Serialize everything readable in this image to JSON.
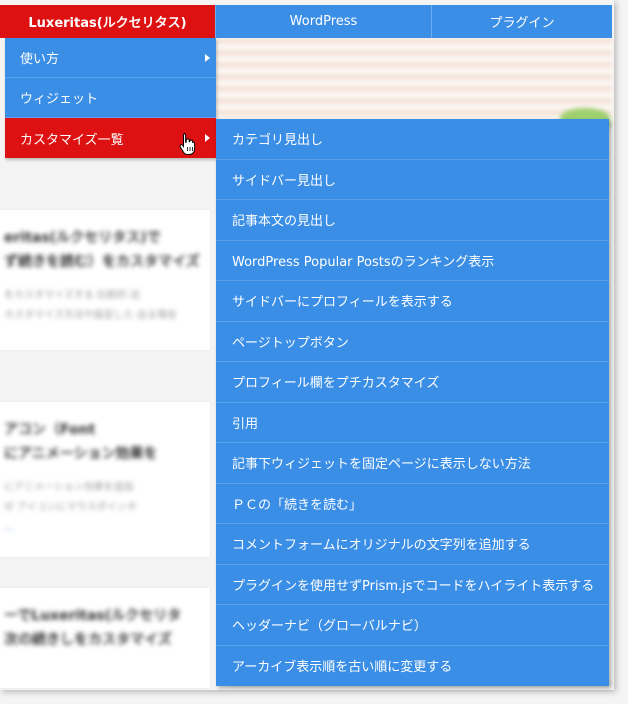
{
  "menubar": {
    "items": [
      {
        "label": "Luxeritas(ルクセリタス)"
      },
      {
        "label": "WordPress"
      },
      {
        "label": "プラグイン"
      }
    ]
  },
  "dropdown": {
    "items": [
      {
        "label": "使い方"
      },
      {
        "label": "ウィジェット"
      },
      {
        "label": "カスタマイズ一覧"
      }
    ]
  },
  "submenu": {
    "items": [
      {
        "label": "カテゴリ見出し"
      },
      {
        "label": "サイドバー見出し"
      },
      {
        "label": "記事本文の見出し"
      },
      {
        "label": "WordPress Popular Postsのランキング表示"
      },
      {
        "label": "サイドバーにプロフィールを表示する"
      },
      {
        "label": "ページトップボタン"
      },
      {
        "label": "プロフィール欄をプチカスタマイズ"
      },
      {
        "label": "引用"
      },
      {
        "label": "記事下ウィジェットを固定ページに表示しない方法"
      },
      {
        "label": "ＰＣの「続きを読む」"
      },
      {
        "label": "コメントフォームにオリジナルの文字列を追加する"
      },
      {
        "label": "プラグインを使用せずPrism.jsでコードをハイライト表示する"
      },
      {
        "label": "ヘッダーナビ（グローバルナビ）"
      },
      {
        "label": "アーカイブ表示順を古い順に変更する"
      }
    ]
  },
  "background": {
    "cards": [
      {
        "title1": "eritas(ルクセリタス)で",
        "title2": "ず続きを読む）をカスタマイズ",
        "desc1": "をカスタマイズする 比較的 出",
        "desc2": "カスタマイズ方法や設定した 出る場合"
      },
      {
        "title1": "アコン（Font",
        "title2": "にアニメーション効果を",
        "desc1": "にアニメーション効果を追加",
        "desc2": "ぜ アイコンにマウスポインタ",
        "link": "..."
      },
      {
        "title1": "ーでLuxeritas(ルクセリタ",
        "title2": "次の続きしをカスタマイズ",
        "desc1": "",
        "desc2": ""
      }
    ]
  },
  "colors": {
    "menu_blue": "#3a8ee6",
    "active_red": "#dd1111"
  }
}
